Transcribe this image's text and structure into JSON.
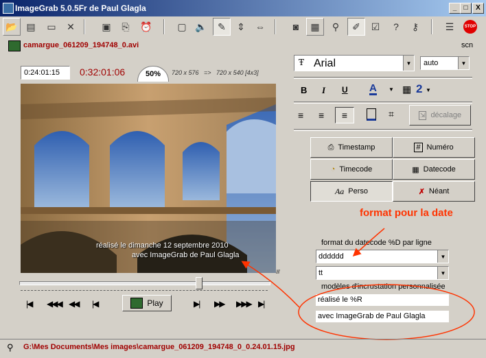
{
  "window": {
    "title": "ImageGrab 5.0.5Fr de Paul Glagla",
    "btn_min": "_",
    "btn_max": "□",
    "btn_close": "X"
  },
  "file": {
    "name": "camargue_061209_194748_0.avi",
    "scn": "scn"
  },
  "time": {
    "position": "0:24:01:15",
    "duration": "0:32:01:06",
    "zoom": "50%",
    "resolution": "720 x 576   =>   720 x 540 [4x3]"
  },
  "overlay": {
    "line1": "réalisé le dimanche 12 septembre 2010",
    "line2": "avec ImageGrab de Paul Glagla"
  },
  "slider": {
    "position": 0.72
  },
  "play_label": "Play",
  "font": {
    "family": "Arial",
    "size": "auto",
    "bold": "B",
    "italic": "I",
    "underline": "U",
    "color_glyph": "A",
    "grid_glyph": "▦",
    "outline_glyph": "2"
  },
  "decalage_label": "décalage",
  "modes": {
    "timestamp": "Timestamp",
    "numero": "Numéro",
    "timecode": "Timecode",
    "datecode": "Datecode",
    "perso": "Perso",
    "neant": "Néant"
  },
  "annotation": "format pour la date",
  "datecode": {
    "label": "format du datecode %D par ligne",
    "line1": "dddddd",
    "line2": "tt"
  },
  "models": {
    "label": "modèles d'incrustation personnalisée",
    "line1": "réalisé le %R",
    "line2": "avec ImageGrab de Paul Glagla"
  },
  "status": {
    "path": "G:\\Mes Documents\\Mes images\\camargue_061209_194748_0_0.24.01.15.jpg"
  },
  "colors": {
    "title_bar_start": "#0a246a",
    "title_bar_end": "#a6caf0",
    "accent_red": "#ff3300",
    "file_red": "#a00000",
    "panel": "#d4d0c8"
  }
}
